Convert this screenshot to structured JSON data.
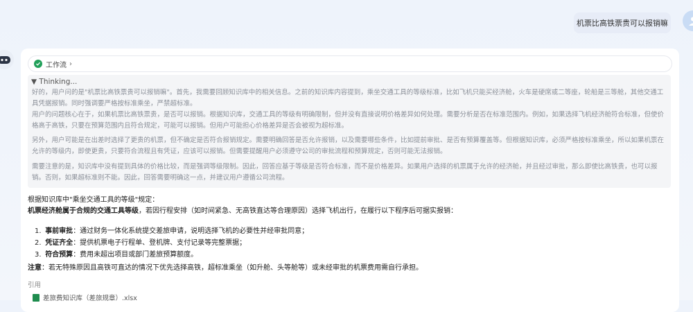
{
  "user": {
    "message": "机票比高铁票贵可以报销嘛"
  },
  "workflow": {
    "label": "工作流"
  },
  "thinking": {
    "header": "▼ Thinking...",
    "p1": "好的，用户问的是\"机票比高铁票贵可以报销嘛\"。首先，我需要回顾知识库中的相关信息。之前的知识库内容提到，乘坐交通工具的等级标准，比如飞机只能买经济舱，火车是硬席或二等座，轮船是三等舱，其他交通工具凭据报销。同时强调要严格按标准乘坐，严禁超标准。",
    "p2": "用户的问题核心在于，如果机票比高铁票贵，是否可以报销。根据知识库，交通工具的等级有明确限制，但并没有直接说明价格差异如何处理。需要分析是否在标准范围内。例如，如果选择飞机经济舱符合标准，但使价格高于高铁，只要在预算范围内且符合规定，可能可以报销。但用户可能担心价格差异是否会被视为超标准。",
    "p3": "另外，用户可能是在出差时选择了更贵的机票，但不确定是否符合报销规定。需要明确回答是否允许报销，以及需要哪些条件，比如提前审批、是否有预算覆盖等。但根据知识库，必须严格按标准乘坐，所以如果机票在允许的等级内，即使更贵，只要符合流程且有凭证，应该可以报销。但需要提醒用户必须遵守公司的审批流程和预算规定，否则可能无法报销。",
    "p4": "需要注意的是，知识库中没有提到具体的价格比较，而是强调等级限制。因此，回答应基于等级是否符合标准，而不是价格差异。如果用户选择的机票属于允许的经济舱，并且经过审批，那么即使比高铁贵，也可以报销。否则，如果超标准则不能。因此，回答需要明确这一点，并建议用户遵循公司流程。"
  },
  "answer": {
    "intro": "根据知识库中\"乘坐交通工具的等级\"规定：",
    "rule_bold": "机票经济舱属于合规的交通工具等级",
    "rule_rest": "，若因行程安排（如时间紧急、无高铁直达等合理原因）选择飞机出行，在履行以下程序后可据实报销：",
    "items": [
      {
        "num": "1.",
        "title": "事前审批",
        "text": "：通过财务一体化系统提交差旅申请，说明选择飞机的必要性并经审批同意；"
      },
      {
        "num": "2.",
        "title": "凭证齐全",
        "text": "：提供机票电子行程单、登机牌、支付记录等完整票据；"
      },
      {
        "num": "3.",
        "title": "符合预算",
        "text": "：费用未超出项目或部门差旅预算额度。"
      }
    ],
    "note_bold": "注意",
    "note_rest": "：若无特殊原因且高铁可直达的情况下优先选择高铁，超标准乘坐（如升舱、头等舱等）或未经审批的机票费用需自行承担。"
  },
  "citation": {
    "label": "引用",
    "file": "差旅费知识库（差旅规章）.xlsx"
  }
}
